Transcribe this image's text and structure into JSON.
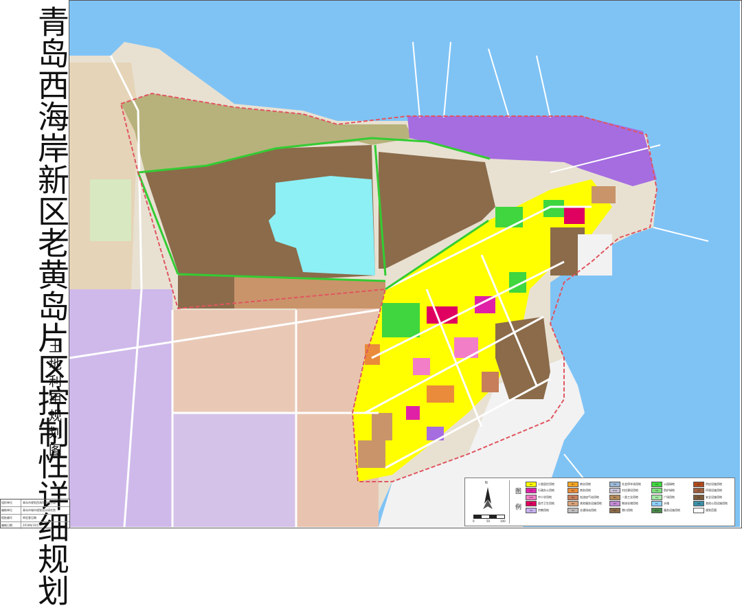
{
  "title": "青岛西海岸新区老黄岛片区控制性详细规划",
  "subtitle": "土地利用规划图",
  "info_table": [
    {
      "key": "组织单位",
      "value": "青岛市规划西海岸新区分局"
    },
    {
      "key": "编制单位",
      "value": "青岛市城市规划设计研究院"
    },
    {
      "key": "报批编号",
      "value": "审定意见稿"
    },
    {
      "key": "编制日期",
      "value": "2018年10月"
    }
  ],
  "legend": {
    "north_label": "N",
    "heading": "图例",
    "scale_labels": [
      "0",
      "50",
      "100"
    ],
    "items": [
      {
        "code": "R2",
        "label": "二类居住用地",
        "color": "#ffff00"
      },
      {
        "code": "B1",
        "label": "商业用地",
        "color": "#f5a623"
      },
      {
        "code": "S3",
        "label": "社会停车场用地",
        "color": "#9bb8d8"
      },
      {
        "code": "G1",
        "label": "公园绿地",
        "color": "#3fd63f"
      },
      {
        "code": "U1",
        "label": "供应设施用地",
        "color": "#b04a1c"
      },
      {
        "code": "A1",
        "label": "行政办公用地",
        "color": "#e021a8"
      },
      {
        "code": "B2",
        "label": "商务用地",
        "color": "#e98b3a"
      },
      {
        "code": "H14",
        "label": "村庄建设用地",
        "color": "#c9c3d8"
      },
      {
        "code": "G2",
        "label": "防护绿地",
        "color": "#7ee07e"
      },
      {
        "code": "U2",
        "label": "环境设施用地",
        "color": "#a06040"
      },
      {
        "code": "A33",
        "label": "中小学用地",
        "color": "#f37ec8"
      },
      {
        "code": "B4",
        "label": "加油加气站用地",
        "color": "#c77e5a"
      },
      {
        "code": "M1",
        "label": "一类工业用地",
        "color": "#b58a5a"
      },
      {
        "code": "G3",
        "label": "广场用地",
        "color": "#a6e9a6"
      },
      {
        "code": "U3",
        "label": "安全设施用地",
        "color": "#7a5a3a"
      },
      {
        "code": "A5",
        "label": "医疗卫生用地",
        "color": "#e0005f"
      },
      {
        "code": "B9",
        "label": "其他服务设施用地",
        "color": "#d9a27a"
      },
      {
        "code": "W1",
        "label": "物流仓储用地",
        "color": "#c48ad8"
      },
      {
        "code": "E1",
        "label": "水域",
        "color": "#8fd0ff"
      },
      {
        "code": "U9",
        "label": "其他公用设施用地",
        "color": "#3a8fa8"
      },
      {
        "code": "A9",
        "label": "宗教用地",
        "color": "#c6b2f0"
      },
      {
        "code": "S4",
        "label": "交通场站用地",
        "color": "#bdbdbd"
      },
      {
        "code": "H2",
        "label": "港口用地",
        "color": "#8a6a48"
      },
      {
        "code": "R22",
        "label": "服务设施用地",
        "color": "#4a8a4a"
      },
      {
        "code": "",
        "label": "规划范围",
        "color": "#ffffff"
      }
    ]
  },
  "map": {
    "sea_color": "#7fc3f5",
    "boundary_color": "#e0555f",
    "road_color": "#ffffff",
    "green_belt_color": "#33cc33"
  }
}
